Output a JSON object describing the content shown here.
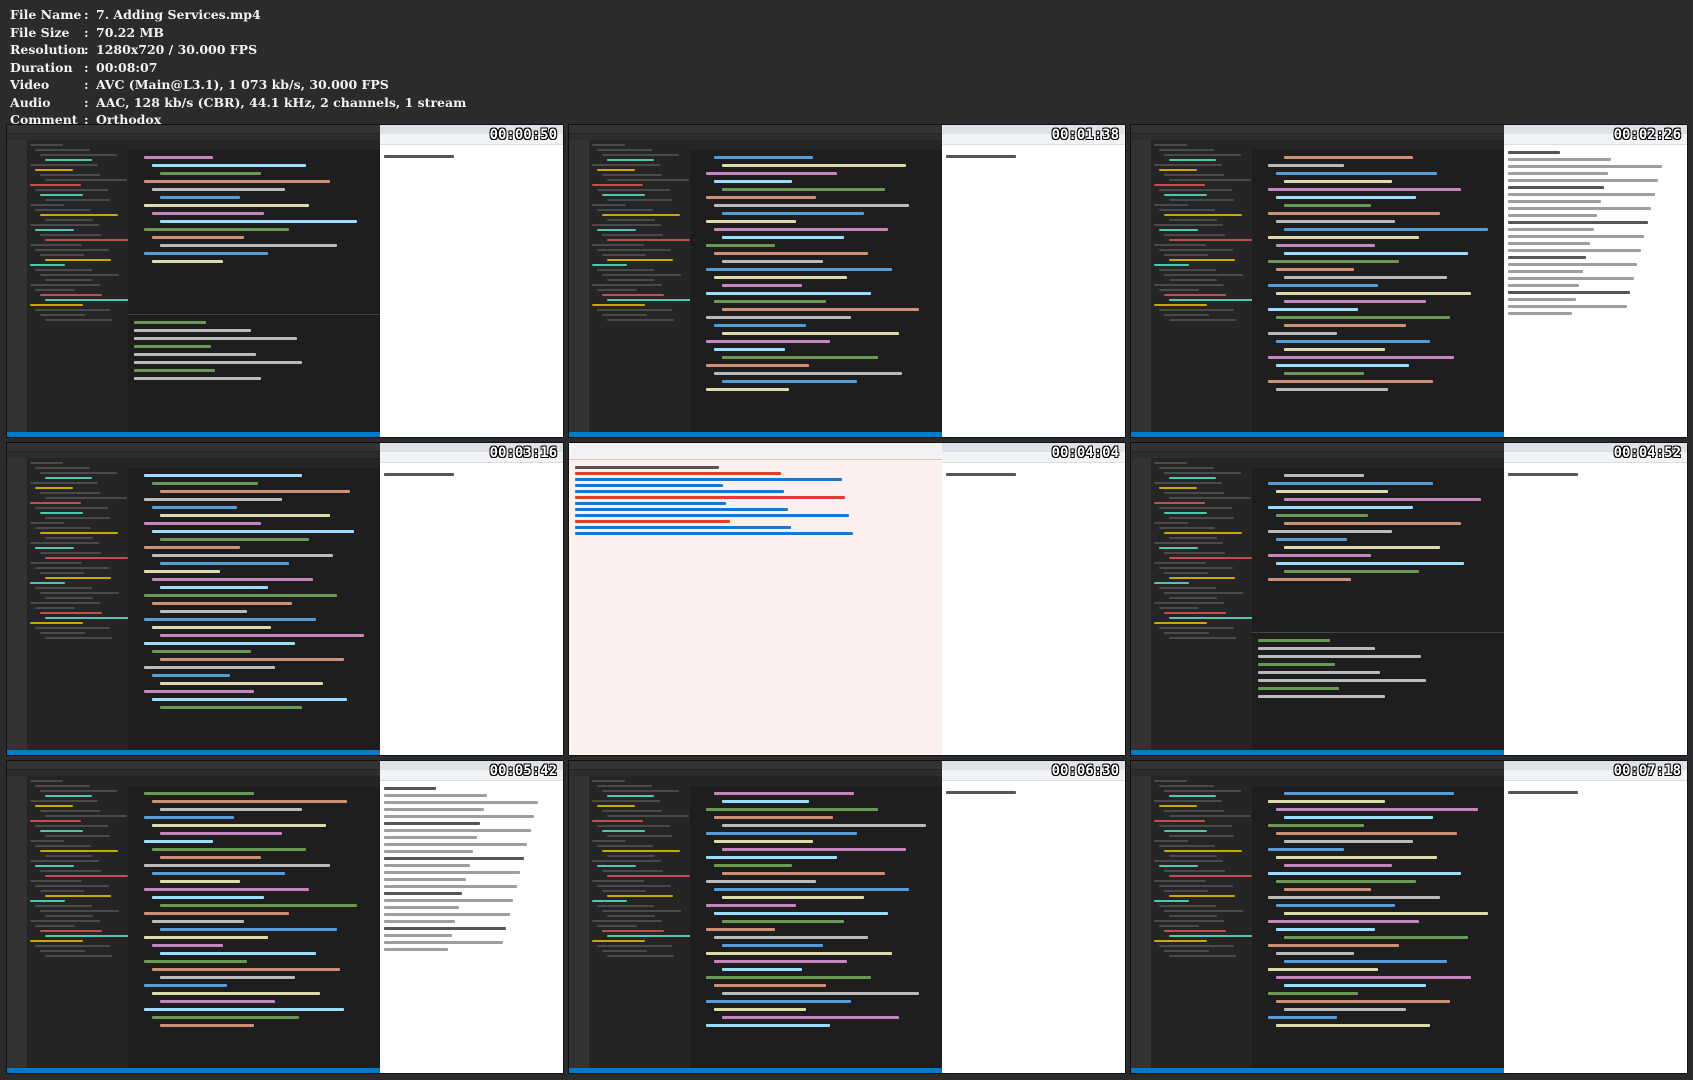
{
  "metadata": [
    {
      "key": "File Name",
      "value": "7. Adding Services.mp4"
    },
    {
      "key": "File Size",
      "value": "70.22 MB"
    },
    {
      "key": "Resolution",
      "value": "1280x720 / 30.000 FPS"
    },
    {
      "key": "Duration",
      "value": "00:08:07"
    },
    {
      "key": "Video",
      "value": "AVC (Main@L3.1), 1 073 kb/s, 30.000 FPS"
    },
    {
      "key": "Audio",
      "value": "AAC, 128 kb/s (CBR), 44.1 kHz, 2 channels, 1 stream"
    },
    {
      "key": "Comment",
      "value": "Orthodox"
    }
  ],
  "separator": ":",
  "thumbnails": [
    {
      "timestamp": "00:00:50"
    },
    {
      "timestamp": "00:01:38"
    },
    {
      "timestamp": "00:02:26"
    },
    {
      "timestamp": "00:03:16"
    },
    {
      "timestamp": "00:04:04"
    },
    {
      "timestamp": "00:04:52"
    },
    {
      "timestamp": "00:05:42"
    },
    {
      "timestamp": "00:06:30"
    },
    {
      "timestamp": "00:07:18"
    }
  ]
}
